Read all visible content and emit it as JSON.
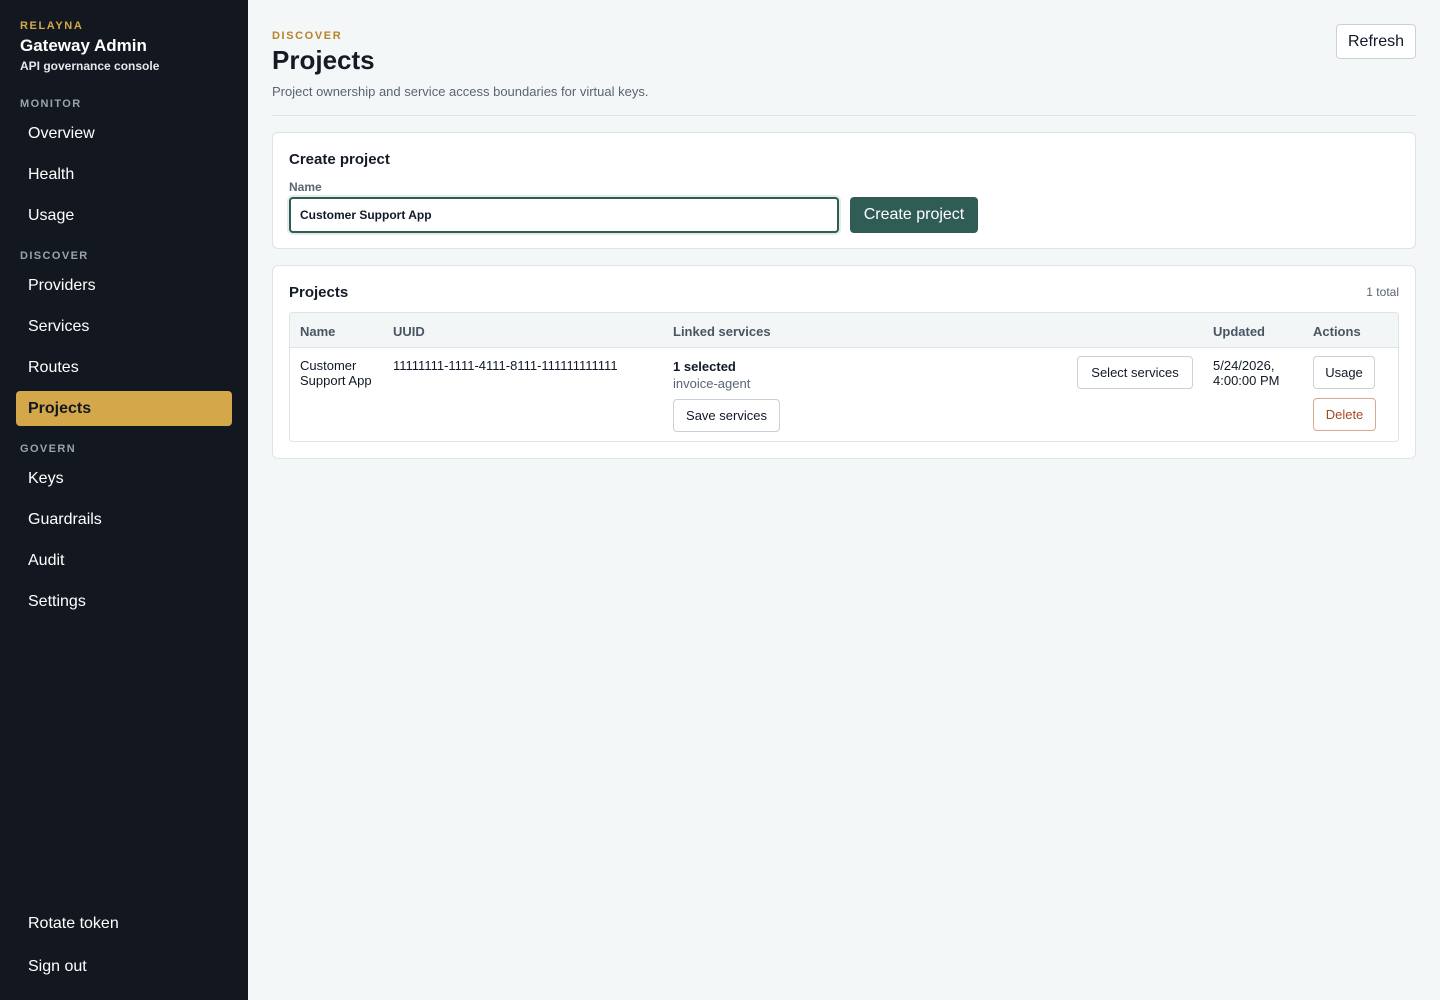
{
  "brand": {
    "kicker": "RELAYNA",
    "title": "Gateway Admin",
    "subtitle": "API governance console"
  },
  "nav": {
    "monitor_label": "MONITOR",
    "monitor_items": [
      "Overview",
      "Health",
      "Usage"
    ],
    "discover_label": "DISCOVER",
    "discover_items": [
      "Providers",
      "Services",
      "Routes",
      "Projects"
    ],
    "govern_label": "GOVERN",
    "govern_items": [
      "Keys",
      "Guardrails",
      "Audit",
      "Settings"
    ],
    "active": "Projects",
    "bottom_items": [
      "Rotate token",
      "Sign out"
    ]
  },
  "header": {
    "kicker": "DISCOVER",
    "title": "Projects",
    "description": "Project ownership and service access boundaries for virtual keys.",
    "refresh_label": "Refresh"
  },
  "create": {
    "title": "Create project",
    "name_label": "Name",
    "name_value": "Customer Support App",
    "submit_label": "Create project"
  },
  "projects": {
    "title": "Projects",
    "total": "1 total",
    "columns": [
      "Name",
      "UUID",
      "Linked services",
      "Updated",
      "Actions"
    ],
    "rows": [
      {
        "name": "Customer Support App",
        "uuid": "11111111-1111-4111-8111-111111111111",
        "selected_count": "1 selected",
        "service": "invoice-agent",
        "save_label": "Save services",
        "select_label": "Select services",
        "updated": "5/24/2026, 4:00:00 PM",
        "usage_label": "Usage",
        "delete_label": "Delete"
      }
    ]
  },
  "colors": {
    "sidebar_bg": "#131820",
    "accent_gold": "#d4a84a",
    "primary_green": "#2f5d55",
    "danger": "#a34a2a"
  }
}
